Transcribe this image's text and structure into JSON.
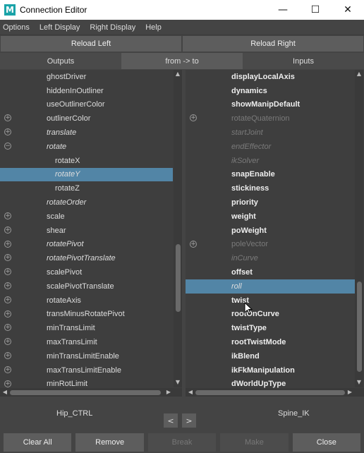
{
  "window": {
    "title": "Connection Editor",
    "minimize_icon": "minimize-icon",
    "maximize_icon": "maximize-icon",
    "close_icon": "close-icon"
  },
  "menu": {
    "items": [
      "Options",
      "Left Display",
      "Right Display",
      "Help"
    ]
  },
  "reload": {
    "left": "Reload Left",
    "right": "Reload Right"
  },
  "tabs": {
    "outputs": "Outputs",
    "direction": "from -> to",
    "inputs": "Inputs"
  },
  "left_list": {
    "items": [
      {
        "label": "ghostDriver",
        "indent": 1,
        "expander": "",
        "style": "normal"
      },
      {
        "label": "hiddenInOutliner",
        "indent": 1,
        "expander": "",
        "style": "normal"
      },
      {
        "label": "useOutlinerColor",
        "indent": 1,
        "expander": "",
        "style": "normal"
      },
      {
        "label": "outlinerColor",
        "indent": 1,
        "expander": "+",
        "style": "normal"
      },
      {
        "label": "translate",
        "indent": 1,
        "expander": "+",
        "style": "italic"
      },
      {
        "label": "rotate",
        "indent": 1,
        "expander": "-",
        "style": "italic"
      },
      {
        "label": "rotateX",
        "indent": 2,
        "expander": "",
        "style": "normal"
      },
      {
        "label": "rotateY",
        "indent": 2,
        "expander": "",
        "style": "italic",
        "selected": true
      },
      {
        "label": "rotateZ",
        "indent": 2,
        "expander": "",
        "style": "normal"
      },
      {
        "label": "rotateOrder",
        "indent": 1,
        "expander": "",
        "style": "italic"
      },
      {
        "label": "scale",
        "indent": 1,
        "expander": "+",
        "style": "normal"
      },
      {
        "label": "shear",
        "indent": 1,
        "expander": "+",
        "style": "normal"
      },
      {
        "label": "rotatePivot",
        "indent": 1,
        "expander": "+",
        "style": "italic"
      },
      {
        "label": "rotatePivotTranslate",
        "indent": 1,
        "expander": "+",
        "style": "italic"
      },
      {
        "label": "scalePivot",
        "indent": 1,
        "expander": "+",
        "style": "normal"
      },
      {
        "label": "scalePivotTranslate",
        "indent": 1,
        "expander": "+",
        "style": "normal"
      },
      {
        "label": "rotateAxis",
        "indent": 1,
        "expander": "+",
        "style": "normal"
      },
      {
        "label": "transMinusRotatePivot",
        "indent": 1,
        "expander": "+",
        "style": "normal"
      },
      {
        "label": "minTransLimit",
        "indent": 1,
        "expander": "+",
        "style": "normal"
      },
      {
        "label": "maxTransLimit",
        "indent": 1,
        "expander": "+",
        "style": "normal"
      },
      {
        "label": "minTransLimitEnable",
        "indent": 1,
        "expander": "+",
        "style": "normal"
      },
      {
        "label": "maxTransLimitEnable",
        "indent": 1,
        "expander": "+",
        "style": "normal"
      },
      {
        "label": "minRotLimit",
        "indent": 1,
        "expander": "+",
        "style": "normal"
      }
    ]
  },
  "right_list": {
    "items": [
      {
        "label": "displayLocalAxis",
        "expander": "",
        "style": "bold"
      },
      {
        "label": "dynamics",
        "expander": "",
        "style": "bold"
      },
      {
        "label": "showManipDefault",
        "expander": "",
        "style": "bold"
      },
      {
        "label": "rotateQuaternion",
        "expander": "+",
        "style": "dimplain"
      },
      {
        "label": "startJoint",
        "expander": "",
        "style": "dim"
      },
      {
        "label": "endEffector",
        "expander": "",
        "style": "dim"
      },
      {
        "label": "ikSolver",
        "expander": "",
        "style": "dim"
      },
      {
        "label": "snapEnable",
        "expander": "",
        "style": "bold"
      },
      {
        "label": "stickiness",
        "expander": "",
        "style": "bold"
      },
      {
        "label": "priority",
        "expander": "",
        "style": "bold"
      },
      {
        "label": "weight",
        "expander": "",
        "style": "bold"
      },
      {
        "label": "poWeight",
        "expander": "",
        "style": "bold"
      },
      {
        "label": "poleVector",
        "expander": "+",
        "style": "dimplain"
      },
      {
        "label": "inCurve",
        "expander": "",
        "style": "dim"
      },
      {
        "label": "offset",
        "expander": "",
        "style": "bold"
      },
      {
        "label": "roll",
        "expander": "",
        "style": "italic",
        "selected": true
      },
      {
        "label": "twist",
        "expander": "",
        "style": "bold"
      },
      {
        "label": "rootOnCurve",
        "expander": "",
        "style": "bold"
      },
      {
        "label": "twistType",
        "expander": "",
        "style": "bold"
      },
      {
        "label": "rootTwistMode",
        "expander": "",
        "style": "bold"
      },
      {
        "label": "ikBlend",
        "expander": "",
        "style": "bold"
      },
      {
        "label": "ikFkManipulation",
        "expander": "",
        "style": "bold"
      },
      {
        "label": "dWorldUpType",
        "expander": "",
        "style": "bold"
      }
    ]
  },
  "nodes": {
    "left": "Hip_CTRL",
    "right": "Spine_IK",
    "prev": "<",
    "next": ">"
  },
  "actions": {
    "clear_all": "Clear All",
    "remove": "Remove",
    "break": "Break",
    "make": "Make",
    "close": "Close"
  },
  "colors": {
    "selection": "#5285a6",
    "background": "#444444",
    "panel": "#3e3e3e",
    "button": "#5d5d5d",
    "logo": "#1aa3a8"
  }
}
